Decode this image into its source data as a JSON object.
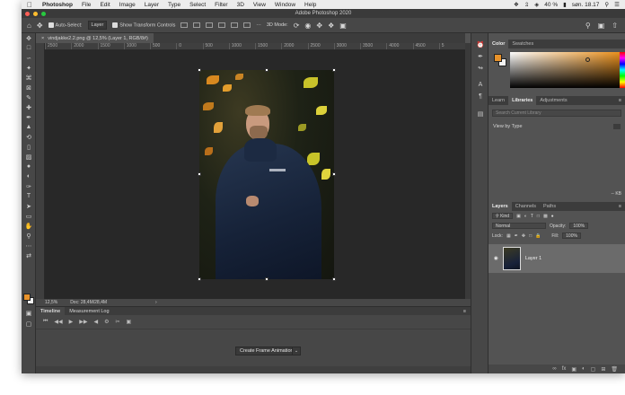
{
  "menubar": {
    "app_name": "Photoshop",
    "items": [
      "File",
      "Edit",
      "Image",
      "Layer",
      "Type",
      "Select",
      "Filter",
      "3D",
      "View",
      "Window",
      "Help"
    ],
    "battery": "40 %",
    "clock": "søn. 18.17"
  },
  "window": {
    "title": "Adobe Photoshop 2020"
  },
  "options_bar": {
    "auto_select_label": "Auto-Select:",
    "auto_select_value": "Layer",
    "transform_controls_label": "Show Transform Controls",
    "mode_3d_label": "3D Mode:"
  },
  "document": {
    "tab_label": "vindjakke2.2.png @ 12,5% (Layer 1, RGB/8#)",
    "zoom": "12,5%",
    "doc_size": "Doc: 28,4M/28,4M"
  },
  "rulers": {
    "h_ticks": [
      "2500",
      "2000",
      "1500",
      "1000",
      "500",
      "0",
      "500",
      "1000",
      "1500",
      "2000",
      "2500",
      "3000",
      "3500",
      "4000",
      "4500",
      "5"
    ]
  },
  "timeline": {
    "tabs": [
      "Timeline",
      "Measurement Log"
    ],
    "create_button_label": "Create Frame Animation"
  },
  "color_panel": {
    "tabs": [
      "Color",
      "Swatches"
    ],
    "foreground": "#e8922a",
    "background": "#f2f2f2"
  },
  "libraries_panel": {
    "tabs": [
      "Learn",
      "Libraries",
      "Adjustments"
    ],
    "search_placeholder": "Search Current Library",
    "view_by_label": "View by Type",
    "size_label": "-- KB"
  },
  "layers_panel": {
    "tabs": [
      "Layers",
      "Channels",
      "Paths"
    ],
    "filter_label": "Kind",
    "blend_mode": "Normal",
    "opacity_label": "Opacity:",
    "opacity_value": "100%",
    "lock_label": "Lock:",
    "fill_label": "Fill:",
    "fill_value": "100%",
    "layer_name": "Layer 1"
  }
}
